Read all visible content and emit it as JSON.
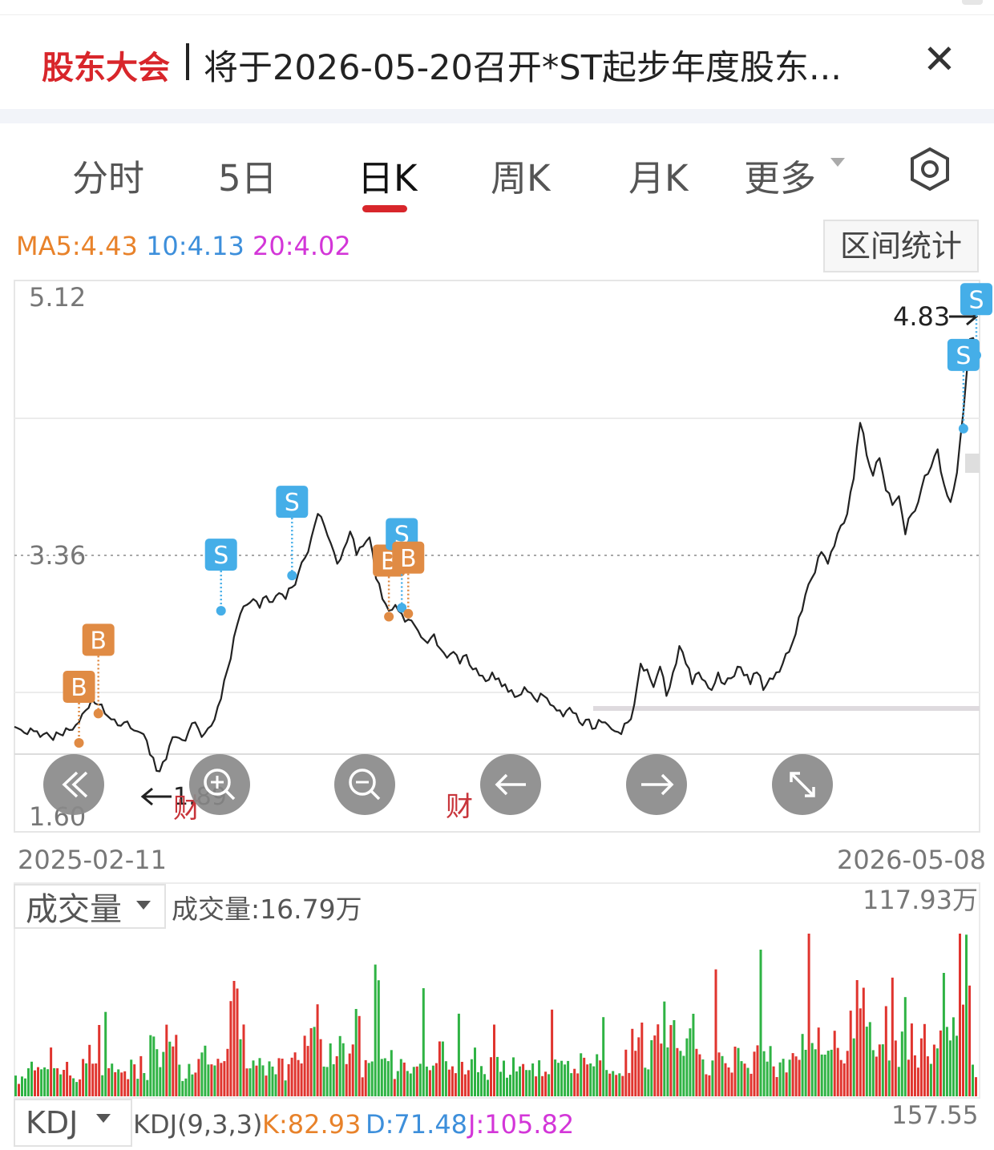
{
  "notice": {
    "tag": "股东大会",
    "text": "将于2026-05-20召开*ST起步年度股东...",
    "close_icon": "close-icon"
  },
  "tabs": [
    {
      "label": "分时",
      "active": false
    },
    {
      "label": "5日",
      "active": false
    },
    {
      "label": "日K",
      "active": true
    },
    {
      "label": "周K",
      "active": false
    },
    {
      "label": "月K",
      "active": false
    },
    {
      "label": "更多",
      "active": false
    }
  ],
  "settings_icon": "settings-hexagon-icon",
  "ma": {
    "ma5": "MA5:4.43",
    "ma10": "10:4.13",
    "ma20": "20:4.02",
    "colors": {
      "ma5": "#e8822a",
      "ma10": "#3d8fdb",
      "ma20": "#d336d8"
    }
  },
  "stats_button": "区间统计",
  "price_chart": {
    "y_max_label": "5.12",
    "y_mid_label": "3.36",
    "y_min_label": "1.60",
    "high_marker": "4.83",
    "low_marker": "1.89",
    "start_date": "2025-02-11",
    "end_date": "2026-05-08",
    "finance_tag": "财"
  },
  "chart_controls": [
    {
      "name": "jump-start-button",
      "icon": "double-chevron-left-icon"
    },
    {
      "name": "zoom-in-button",
      "icon": "zoom-in-icon"
    },
    {
      "name": "zoom-out-button",
      "icon": "zoom-out-icon"
    },
    {
      "name": "pan-left-button",
      "icon": "arrow-left-icon"
    },
    {
      "name": "pan-right-button",
      "icon": "arrow-right-icon"
    },
    {
      "name": "fullscreen-button",
      "icon": "expand-icon"
    }
  ],
  "volume": {
    "selector": "成交量",
    "current": "成交量:16.79万",
    "max_label": "117.93万"
  },
  "kdj": {
    "selector": "KDJ",
    "params": "KDJ(9,3,3)",
    "k": "K:82.93",
    "d": "D:71.48",
    "j": "J:105.82",
    "max_label": "157.55"
  },
  "colors": {
    "up": "#e0342e",
    "down": "#2fb344",
    "buy": "#e08b44",
    "sell": "#45aee8",
    "brand": "#d8262b"
  },
  "chart_data": {
    "type": "line",
    "x_range": [
      "2025-02-11",
      "2026-05-08"
    ],
    "ylim": [
      1.6,
      5.12
    ],
    "dashed_reference": 3.36,
    "price_min_marked": 1.89,
    "price_max_marked": 4.83,
    "close_series": [
      2.19,
      2.17,
      2.14,
      2.16,
      2.12,
      2.15,
      2.1,
      2.14,
      2.18,
      2.17,
      2.22,
      2.3,
      2.38,
      2.34,
      2.28,
      2.24,
      2.2,
      2.22,
      2.18,
      2.16,
      2.14,
      2.0,
      1.89,
      1.95,
      2.06,
      2.12,
      2.1,
      2.16,
      2.22,
      2.12,
      2.18,
      2.24,
      2.38,
      2.58,
      2.8,
      2.96,
      3.02,
      3.06,
      3.0,
      3.08,
      3.04,
      3.1,
      3.06,
      3.14,
      3.24,
      3.34,
      3.48,
      3.64,
      3.56,
      3.44,
      3.3,
      3.4,
      3.52,
      3.36,
      3.42,
      3.48,
      3.2,
      3.06,
      2.98,
      3.02,
      2.96,
      2.92,
      2.88,
      2.8,
      2.76,
      2.82,
      2.72,
      2.66,
      2.7,
      2.62,
      2.68,
      2.58,
      2.54,
      2.5,
      2.56,
      2.52,
      2.48,
      2.44,
      2.4,
      2.46,
      2.42,
      2.36,
      2.4,
      2.34,
      2.3,
      2.26,
      2.32,
      2.28,
      2.2,
      2.24,
      2.18,
      2.22,
      2.2,
      2.16,
      2.14,
      2.22,
      2.34,
      2.62,
      2.58,
      2.46,
      2.6,
      2.4,
      2.56,
      2.74,
      2.62,
      2.48,
      2.56,
      2.5,
      2.44,
      2.56,
      2.48,
      2.52,
      2.6,
      2.54,
      2.48,
      2.56,
      2.44,
      2.52,
      2.56,
      2.62,
      2.7,
      2.82,
      2.98,
      3.16,
      3.24,
      3.38,
      3.3,
      3.42,
      3.56,
      3.64,
      3.88,
      4.26,
      4.04,
      3.9,
      4.02,
      3.8,
      3.7,
      3.76,
      3.5,
      3.64,
      3.72,
      3.9,
      3.96,
      4.08,
      3.84,
      3.72,
      3.92,
      4.34,
      4.83,
      4.78
    ],
    "volume_unit": "万",
    "volume_max": 117.93,
    "volume_current": 16.79,
    "trade_markers": [
      {
        "type": "B",
        "index": 10,
        "price": 2.08
      },
      {
        "type": "B",
        "index": 13,
        "price": 2.28
      },
      {
        "type": "S",
        "index": 32,
        "price": 2.98
      },
      {
        "type": "S",
        "index": 43,
        "price": 3.22
      },
      {
        "type": "B",
        "index": 58,
        "price": 2.94
      },
      {
        "type": "S",
        "index": 60,
        "price": 3.0
      },
      {
        "type": "B",
        "index": 61,
        "price": 2.96
      },
      {
        "type": "S",
        "index": 147,
        "price": 4.22
      },
      {
        "type": "S",
        "index": 149,
        "price": 4.72
      }
    ]
  }
}
